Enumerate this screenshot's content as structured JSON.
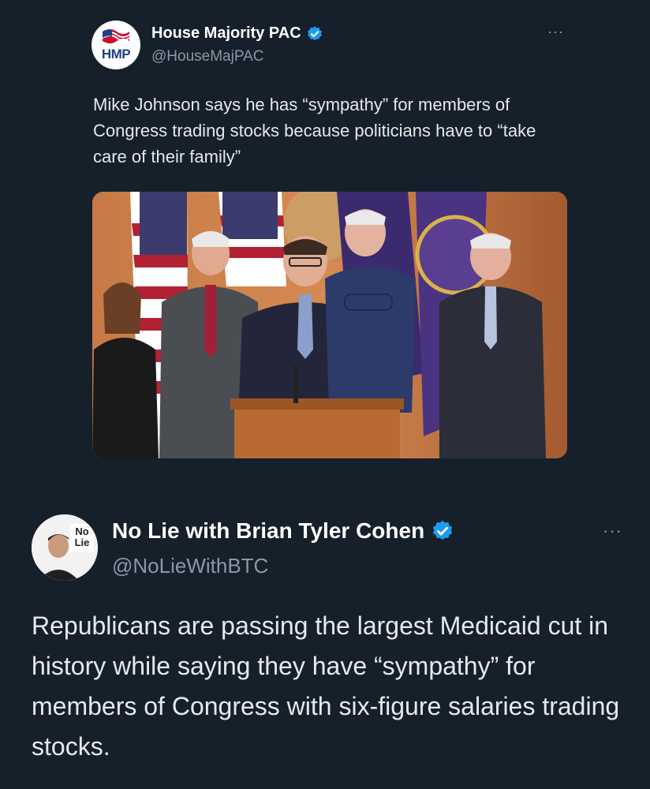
{
  "quoted_tweet": {
    "avatar_text": "HMP",
    "display_name": "House Majority PAC",
    "handle": "@HouseMajPAC",
    "more_label": "···",
    "text": "Mike Johnson says he has “sympathy” for members of Congress trading stocks because politicians have to “take care of their family”",
    "photo_icon": "press-conference-photo"
  },
  "main_tweet": {
    "avatar_text": [
      "No",
      "Lie"
    ],
    "display_name": "No Lie with Brian Tyler Cohen",
    "handle": "@NoLieWithBTC",
    "more_label": "···",
    "text": "Republicans are passing the largest Medicaid cut in history while saying they have “sympathy” for members of Congress with six-figure salaries trading stocks."
  },
  "colors": {
    "background": "#15202b",
    "verified_badge": "#1d9bf0",
    "secondary_text": "#8b98a5"
  }
}
